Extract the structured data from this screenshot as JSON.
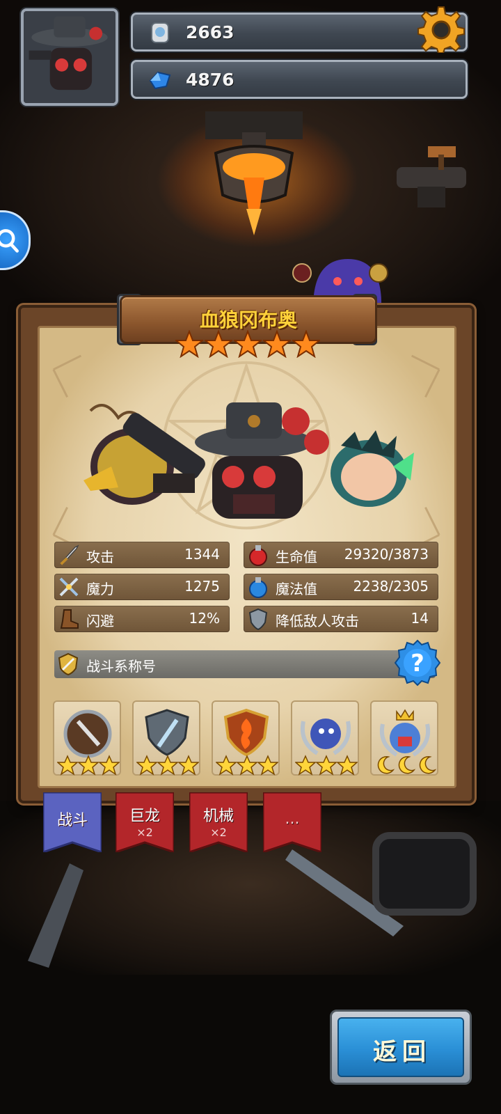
{
  "resources": {
    "silver": {
      "value": "2663",
      "icon": "silver-coin-icon"
    },
    "gems": {
      "value": "4876",
      "icon": "blue-gem-icon"
    }
  },
  "hero": {
    "name": "血狼冈布奥",
    "stars": 5
  },
  "stats": {
    "attack": {
      "label": "攻击",
      "value": "1344",
      "icon": "sword-icon"
    },
    "hp": {
      "label": "生命值",
      "value": "29320/3873",
      "icon": "red-potion-icon"
    },
    "magic": {
      "label": "魔力",
      "value": "1275",
      "icon": "magic-swords-icon"
    },
    "mp": {
      "label": "魔法值",
      "value": "2238/2305",
      "icon": "blue-potion-icon"
    },
    "dodge": {
      "label": "闪避",
      "value": "12%",
      "icon": "boot-icon"
    },
    "defense": {
      "label": "降低敌人攻击",
      "value": "14",
      "icon": "shield-icon"
    }
  },
  "battle_title": {
    "label": "战斗系称号",
    "icon": "title-medal-icon"
  },
  "badges": [
    {
      "icon": "round-shield-dagger-badge-icon",
      "rank": "stars",
      "count": 3
    },
    {
      "icon": "steel-shield-sword-badge-icon",
      "rank": "stars",
      "count": 3
    },
    {
      "icon": "flame-shield-badge-icon",
      "rank": "stars",
      "count": 3
    },
    {
      "icon": "laurel-beast-badge-icon",
      "rank": "stars",
      "count": 3
    },
    {
      "icon": "crowned-laurel-badge-icon",
      "rank": "moons",
      "count": 3
    }
  ],
  "tabs": [
    {
      "label": "战斗",
      "count": "",
      "active": true
    },
    {
      "label": "巨龙",
      "count": "×2",
      "active": false
    },
    {
      "label": "机械",
      "count": "×2",
      "active": false
    },
    {
      "label": "...",
      "count": "",
      "active": false
    }
  ],
  "back_button": {
    "label": "返回"
  },
  "colors": {
    "gold_title": "#ffd23a",
    "parchment": "#efe0bf",
    "stat_row": "#7d6344",
    "active_tab": "#5b63c0",
    "inactive_tab": "#b3262a",
    "back_button": "#2a8fd6"
  }
}
